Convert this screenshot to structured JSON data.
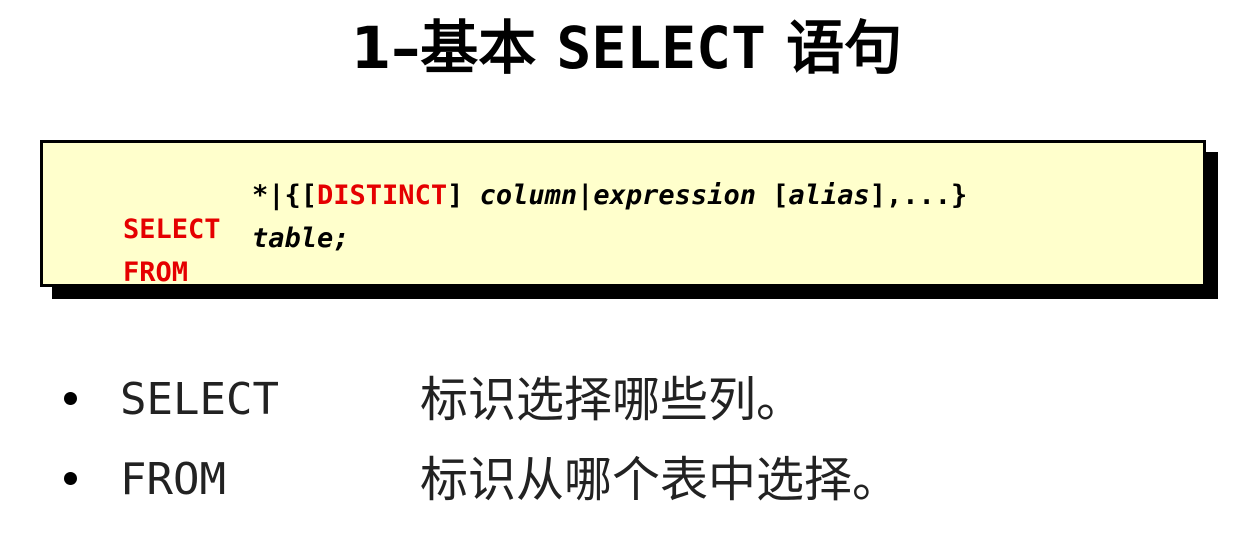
{
  "title": {
    "prefix": "1–基本 ",
    "keyword": "SELECT",
    "suffix": " 语句"
  },
  "syntax": {
    "line1": {
      "keyword": "SELECT",
      "p1": "*|{[",
      "distinct": "DISTINCT",
      "p2": "] ",
      "column": "column",
      "p3": "|",
      "expression": "expression",
      "p4": " [",
      "alias": "alias",
      "p5": "],...}"
    },
    "line2": {
      "keyword": "FROM",
      "table": "table;"
    }
  },
  "bullets": [
    {
      "term": "SELECT",
      "desc": "标识选择哪些列。"
    },
    {
      "term": "FROM",
      "desc": "标识从哪个表中选择。"
    }
  ],
  "colors": {
    "keyword": "#e50000",
    "box_background": "#ffffcc",
    "shadow": "#000000"
  }
}
